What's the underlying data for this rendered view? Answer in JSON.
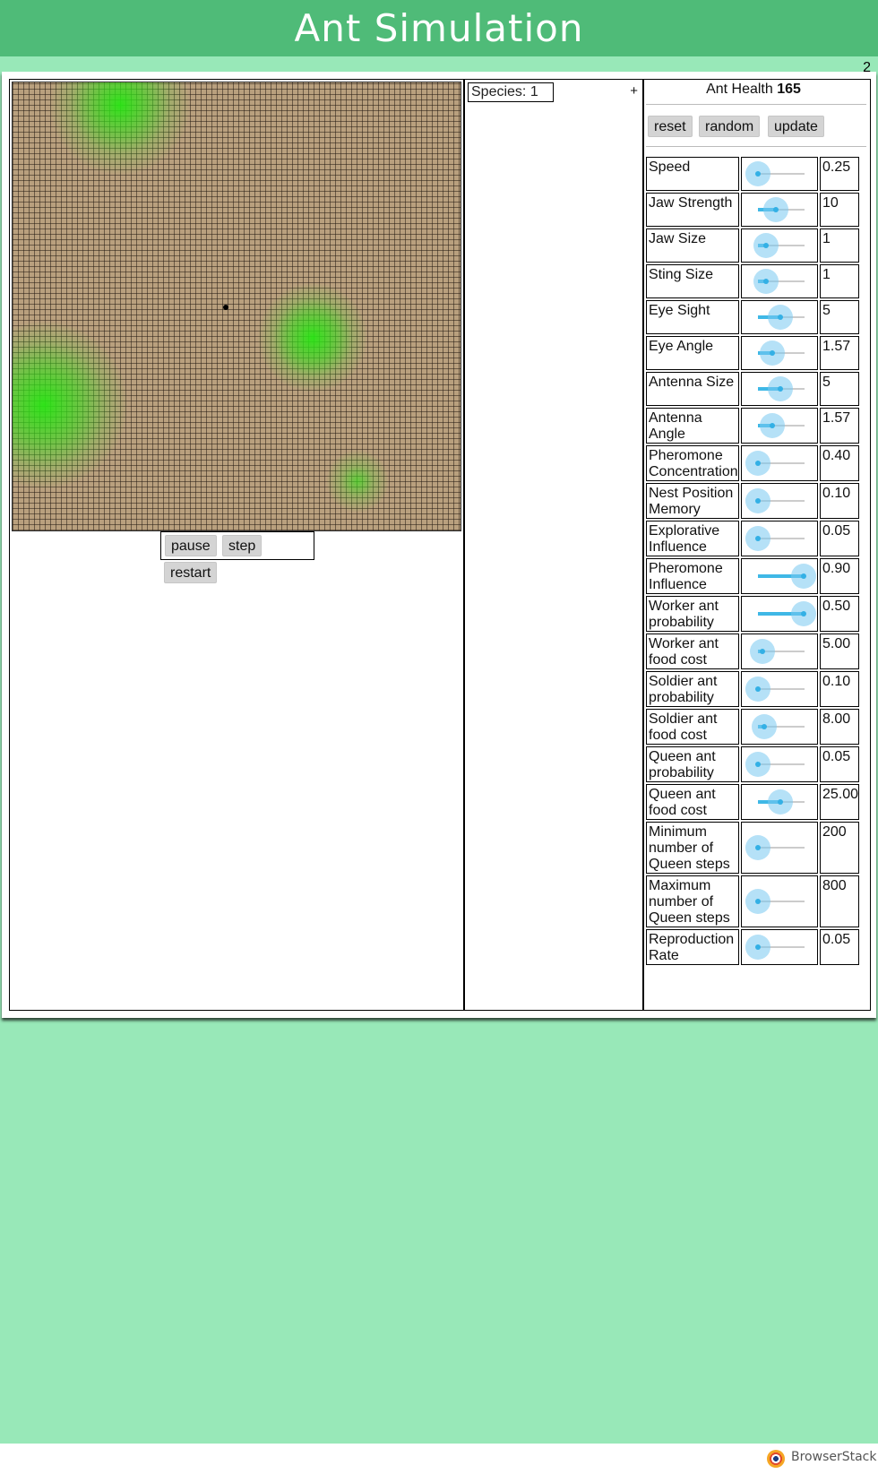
{
  "header": {
    "title": "Ant Simulation"
  },
  "page_number": "2",
  "simulation": {
    "pause_label": "pause",
    "step_label": "step",
    "restart_label": "restart"
  },
  "species_panel": {
    "selector_label": "Species: 1",
    "add_label": "+"
  },
  "settings": {
    "health_label": "Ant Health",
    "health_value": "165",
    "reset_label": "reset",
    "random_label": "random",
    "update_label": "update",
    "params": [
      {
        "label": "Speed",
        "value": "0.25",
        "slider_fraction": 0.0
      },
      {
        "label": "Jaw Strength",
        "value": "10",
        "slider_fraction": 0.38
      },
      {
        "label": "Jaw Size",
        "value": "1",
        "slider_fraction": 0.18
      },
      {
        "label": "Sting Size",
        "value": "1",
        "slider_fraction": 0.18
      },
      {
        "label": "Eye Sight",
        "value": "5",
        "slider_fraction": 0.48
      },
      {
        "label": "Eye Angle",
        "value": "1.57",
        "slider_fraction": 0.3
      },
      {
        "label": "Antenna Size",
        "value": "5",
        "slider_fraction": 0.48
      },
      {
        "label": "Antenna Angle",
        "value": "1.57",
        "slider_fraction": 0.3
      },
      {
        "label": "Pheromone Concentration",
        "value": "0.40",
        "slider_fraction": 0.0
      },
      {
        "label": "Nest Position Memory",
        "value": "0.10",
        "slider_fraction": 0.0
      },
      {
        "label": "Explorative Influence",
        "value": "0.05",
        "slider_fraction": 0.0
      },
      {
        "label": "Pheromone Influence",
        "value": "0.90",
        "slider_fraction": 0.98
      },
      {
        "label": "Worker ant probability",
        "value": "0.50",
        "slider_fraction": 0.98
      },
      {
        "label": "Worker ant food cost",
        "value": "5.00",
        "slider_fraction": 0.1
      },
      {
        "label": "Soldier ant probability",
        "value": "0.10",
        "slider_fraction": 0.0
      },
      {
        "label": "Soldier ant food cost",
        "value": "8.00",
        "slider_fraction": 0.14
      },
      {
        "label": "Queen ant probability",
        "value": "0.05",
        "slider_fraction": 0.0
      },
      {
        "label": "Queen ant food cost",
        "value": "25.00",
        "slider_fraction": 0.48
      },
      {
        "label": "Minimum number of Queen steps",
        "value": "200",
        "slider_fraction": 0.0
      },
      {
        "label": "Maximum number of Queen steps",
        "value": "800",
        "slider_fraction": 0.0
      },
      {
        "label": "Reproduction Rate",
        "value": "0.05",
        "slider_fraction": 0.0
      }
    ]
  },
  "footer": {
    "brand": "BrowserStack"
  },
  "colors": {
    "header": "#4fbb78",
    "background": "#98e8b8",
    "soil": "#b9a07e",
    "food": "#3ee61a",
    "slider": "#3fb8e6"
  }
}
